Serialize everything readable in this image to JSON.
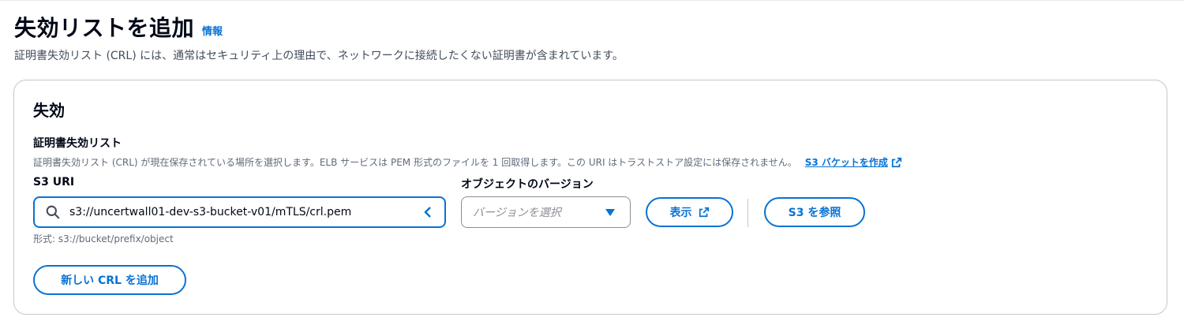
{
  "page": {
    "title": "失効リストを追加",
    "info_link": "情報",
    "description": "証明書失効リスト (CRL) には、通常はセキュリティ上の理由で、ネットワークに接続したくない証明書が含まれています。"
  },
  "revocation": {
    "section_title": "失効",
    "field_label": "証明書失効リスト",
    "field_description": "証明書失効リスト (CRL) が現在保存されている場所を選択します。ELB サービスは PEM 形式のファイルを 1 回取得します。この URI はトラストストア設定には保存されません。",
    "create_bucket_link": "S3 バケットを作成",
    "s3_uri_label": "S3 URI",
    "s3_uri_value": "s3://uncertwall01-dev-s3-bucket-v01/mTLS/crl.pem",
    "object_version_label": "オブジェクトのバージョン",
    "version_placeholder": "バージョンを選択",
    "view_button": "表示",
    "browse_button": "S3 を参照",
    "format_hint": "形式: s3://bucket/prefix/object",
    "add_crl_button": "新しい CRL を追加"
  },
  "icons": {
    "search": "search-icon",
    "clear": "chevron-left-icon",
    "dropdown": "caret-down-icon",
    "external": "external-link-icon"
  },
  "colors": {
    "accent": "#0972d3",
    "text": "#000716",
    "secondary_text": "#5f6b7a",
    "border": "#c6c6cd"
  }
}
